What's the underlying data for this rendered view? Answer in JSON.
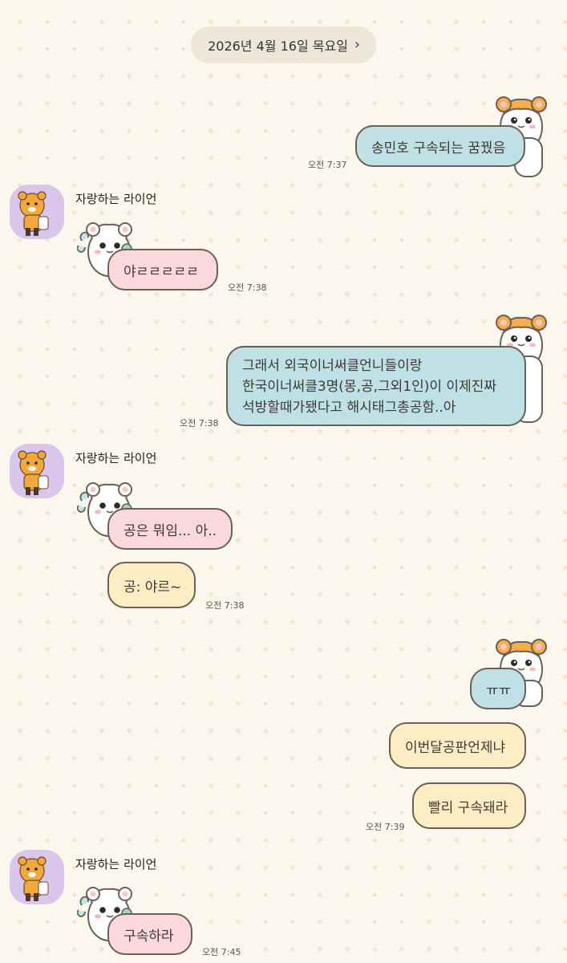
{
  "date_header": {
    "label": "2026년 4월 16일 목요일",
    "chevron": "chevron-right-icon"
  },
  "colors": {
    "background": "#fbf7ec",
    "bubble_blue": "#bfe0e4",
    "bubble_pink": "#fbd8de",
    "bubble_yellow": "#fdedc4",
    "avatar_bg": "#d9c6ea"
  },
  "messages": [
    {
      "sender": "me",
      "text": "송민호 구속되는 꿈꿨음",
      "time": "오전 7:37"
    },
    {
      "sender": "자랑하는 라이언",
      "text": "야ㄹㄹㄹㄹㄹ",
      "time": "오전 7:38"
    },
    {
      "sender": "me",
      "lines": [
        "그래서 외국이너써클언니들이랑",
        "한국이너써클3명(몽,공,그외1인)이 이제진짜",
        "석방할때가됐다고 해시태그총공함..아"
      ],
      "time": "오전 7:38"
    },
    {
      "sender": "자랑하는 라이언",
      "texts": [
        "공은 뭐임... 아..",
        "공: 야르~"
      ],
      "time": "오전 7:38"
    },
    {
      "sender": "me",
      "texts": [
        "ㅠㅠ",
        "이번달공판언제냐",
        "빨리 구속돼라"
      ],
      "time": "오전 7:39"
    },
    {
      "sender": "자랑하는 라이언",
      "text": "구속하라",
      "time": "오전 7:45"
    }
  ]
}
